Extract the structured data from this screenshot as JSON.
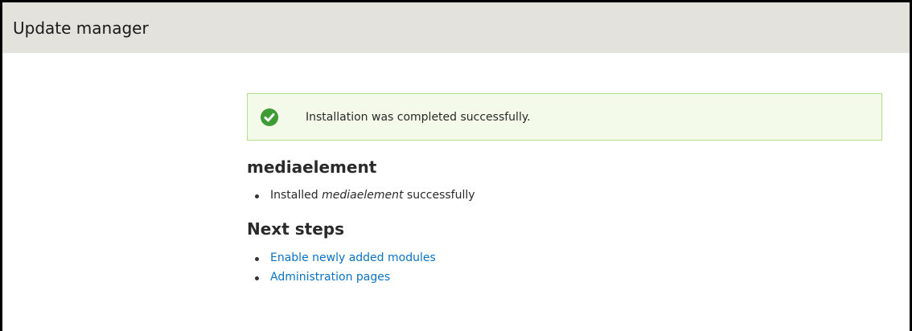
{
  "header": {
    "title": "Update manager"
  },
  "status_message": {
    "text": "Installation was completed successfully.",
    "icon": "check-circle-icon",
    "color": "#3f9c35"
  },
  "module": {
    "name": "mediaelement",
    "result_prefix": "Installed",
    "result_module": "mediaelement",
    "result_suffix": "successfully"
  },
  "next_steps": {
    "title": "Next steps",
    "links": [
      {
        "label": "Enable newly added modules"
      },
      {
        "label": "Administration pages"
      }
    ],
    "link_color": "#0a73c6"
  }
}
